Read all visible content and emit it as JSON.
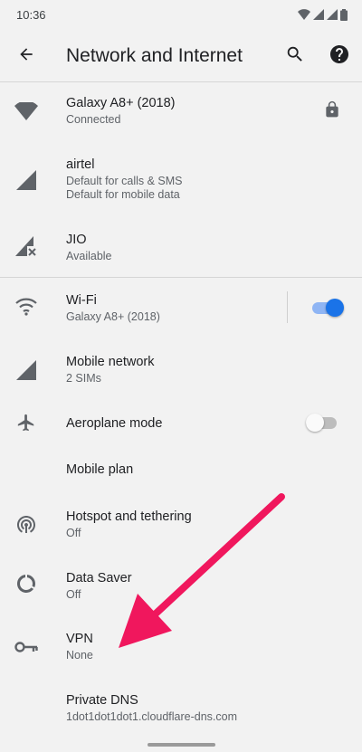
{
  "status_bar": {
    "time": "10:36"
  },
  "app_bar": {
    "title": "Network and Internet"
  },
  "networks": [
    {
      "title": "Galaxy A8+ (2018)",
      "subtitle": "Connected"
    },
    {
      "title": "airtel",
      "subtitle_line1": "Default for calls & SMS",
      "subtitle_line2": "Default for mobile data"
    },
    {
      "title": "JIO",
      "subtitle": "Available"
    }
  ],
  "settings": {
    "wifi": {
      "title": "Wi-Fi",
      "subtitle": "Galaxy A8+ (2018)",
      "enabled": true
    },
    "mobile_network": {
      "title": "Mobile network",
      "subtitle": "2 SIMs"
    },
    "aeroplane": {
      "title": "Aeroplane mode",
      "enabled": false
    },
    "mobile_plan": {
      "title": "Mobile plan"
    },
    "hotspot": {
      "title": "Hotspot and tethering",
      "subtitle": "Off"
    },
    "data_saver": {
      "title": "Data Saver",
      "subtitle": "Off"
    },
    "vpn": {
      "title": "VPN",
      "subtitle": "None"
    },
    "private_dns": {
      "title": "Private DNS",
      "subtitle": "1dot1dot1dot1.cloudflare-dns.com"
    }
  },
  "colors": {
    "accent": "#1a73e8",
    "arrow": "#f0175d",
    "icon": "#5f6368"
  },
  "icons": [
    "back-arrow-icon",
    "search-icon",
    "help-icon",
    "wifi-signal-icon",
    "lock-icon",
    "cell-signal-icon",
    "cell-signal-no-service-icon",
    "wifi-icon",
    "aeroplane-icon",
    "hotspot-icon",
    "data-saver-icon",
    "vpn-key-icon"
  ]
}
